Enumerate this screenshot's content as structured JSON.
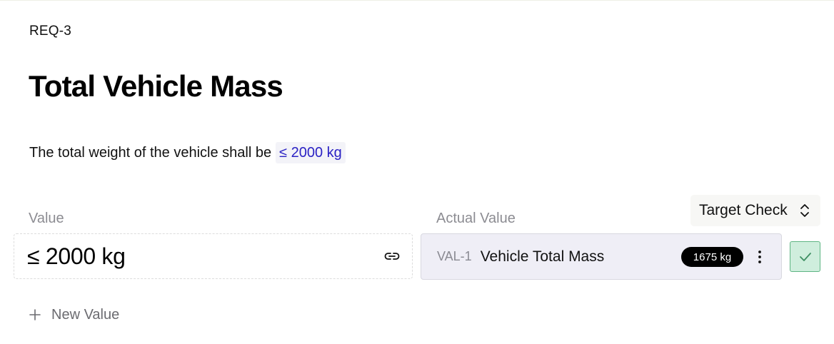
{
  "requirement": {
    "id": "REQ-3",
    "title": "Total Vehicle Mass",
    "description": "The total weight of the vehicle shall be",
    "description_value": "≤ 2000 kg"
  },
  "columns": {
    "value_label": "Value",
    "actual_label": "Actual Value"
  },
  "target_check": {
    "label": "Target Check"
  },
  "value_row": {
    "value": "≤ 2000 kg"
  },
  "actual_value": {
    "id": "VAL-1",
    "name": "Vehicle Total Mass",
    "badge": "1675 kg",
    "status": "pass"
  },
  "actions": {
    "new_value": "New Value"
  },
  "colors": {
    "accent": "#2b22c4",
    "pass_bg": "#cfeedd",
    "pass_border": "#5fb584",
    "actual_bg": "#efeef6"
  },
  "icons": {
    "link": "link-icon",
    "more": "more-vertical-icon",
    "check": "check-icon",
    "chevron": "chevron-up-down-icon",
    "plus": "plus-icon"
  }
}
